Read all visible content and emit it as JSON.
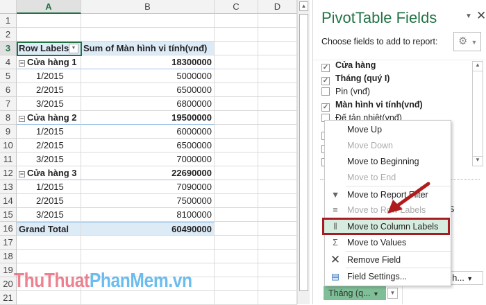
{
  "sheet": {
    "columns": [
      "A",
      "B",
      "C",
      "D"
    ],
    "row_numbers": [
      "1",
      "2",
      "3",
      "4",
      "5",
      "6",
      "7",
      "8",
      "9",
      "10",
      "11",
      "12",
      "13",
      "14",
      "15",
      "16",
      "17",
      "18",
      "19",
      "20",
      "21"
    ],
    "header": {
      "row_labels": "Row Labels",
      "value_header": "Sum of Màn hình vi tính(vnđ)"
    },
    "rows": [
      {
        "label": "Cửa hàng 1",
        "value": "18300000",
        "group": true
      },
      {
        "label": "1/2015",
        "value": "5000000"
      },
      {
        "label": "2/2015",
        "value": "6500000"
      },
      {
        "label": "3/2015",
        "value": "6800000"
      },
      {
        "label": "Cửa hàng 2",
        "value": "19500000",
        "group": true
      },
      {
        "label": "1/2015",
        "value": "6000000"
      },
      {
        "label": "2/2015",
        "value": "6500000"
      },
      {
        "label": "3/2015",
        "value": "7000000"
      },
      {
        "label": "Cửa hàng 3",
        "value": "22690000",
        "group": true
      },
      {
        "label": "1/2015",
        "value": "7090000"
      },
      {
        "label": "2/2015",
        "value": "7500000"
      },
      {
        "label": "3/2015",
        "value": "8100000"
      }
    ],
    "grand_total": {
      "label": "Grand Total",
      "value": "60490000"
    }
  },
  "panel": {
    "title": "PivotTable Fields",
    "subtitle": "Choose fields to add to report:",
    "fields": [
      {
        "label": "Cửa hàng",
        "checked": true
      },
      {
        "label": "Tháng  (quý I)",
        "checked": true
      },
      {
        "label": "Pin (vnđ)",
        "checked": false
      },
      {
        "label": "Màn hình vi tính(vnđ)",
        "checked": true
      },
      {
        "label": "Đế tản nhiệt(vnđ)",
        "checked": false
      }
    ],
    "columns_area_partial": "NS",
    "values_dropdown": "n h...",
    "rows_field_button": "Tháng  (q..."
  },
  "context_menu": {
    "items": [
      {
        "label": "Move Up",
        "disabled": false,
        "icon": ""
      },
      {
        "label": "Move Down",
        "disabled": true,
        "icon": ""
      },
      {
        "label": "Move to Beginning",
        "disabled": false,
        "icon": ""
      },
      {
        "label": "Move to End",
        "disabled": true,
        "icon": ""
      },
      {
        "label": "Move to Report Filter",
        "disabled": false,
        "icon": "filter-icon"
      },
      {
        "label": "Move to Row Labels",
        "disabled": true,
        "icon": "rows-icon"
      },
      {
        "label": "Move to Column Labels",
        "disabled": false,
        "icon": "columns-icon",
        "highlighted": true
      },
      {
        "label": "Move to Values",
        "disabled": false,
        "icon": "sigma-icon"
      },
      {
        "label": "Remove Field",
        "disabled": false,
        "icon": "x-icon"
      },
      {
        "label": "Field Settings...",
        "disabled": false,
        "icon": "field-settings-icon"
      }
    ]
  },
  "watermark": {
    "part1": "ThuThuat",
    "part2": "PhanMem.vn"
  },
  "colors": {
    "accent_green": "#217346",
    "pivot_blue": "#ddebf7",
    "highlight": "#d6ecdf",
    "callout_red": "#b01c1c"
  }
}
